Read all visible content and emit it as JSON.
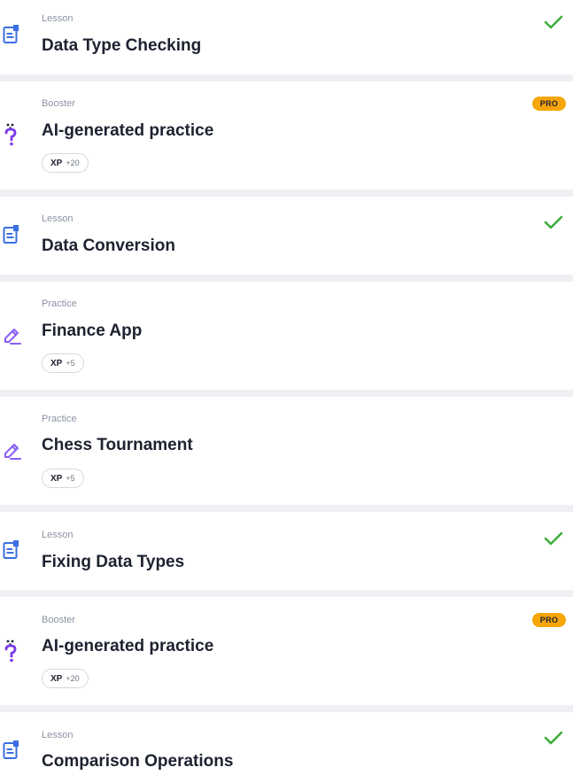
{
  "items": [
    {
      "type": "Lesson",
      "title": "Data Type Checking",
      "icon": "lesson-icon",
      "status": "completed"
    },
    {
      "type": "Booster",
      "title": "AI-generated practice",
      "icon": "question-icon",
      "badge": "PRO",
      "xp_label": "XP",
      "xp_value": "+20"
    },
    {
      "type": "Lesson",
      "title": "Data Conversion",
      "icon": "lesson-icon",
      "status": "completed"
    },
    {
      "type": "Practice",
      "title": "Finance App",
      "icon": "pencil-icon",
      "xp_label": "XP",
      "xp_value": "+5"
    },
    {
      "type": "Practice",
      "title": "Chess Tournament",
      "icon": "pencil-icon",
      "xp_label": "XP",
      "xp_value": "+5"
    },
    {
      "type": "Lesson",
      "title": "Fixing Data Types",
      "icon": "lesson-icon",
      "status": "completed"
    },
    {
      "type": "Booster",
      "title": "AI-generated practice",
      "icon": "question-icon",
      "badge": "PRO",
      "xp_label": "XP",
      "xp_value": "+20"
    },
    {
      "type": "Lesson",
      "title": "Comparison Operations",
      "icon": "lesson-icon",
      "status": "completed"
    }
  ],
  "colors": {
    "lesson_icon": "#3b6fe0",
    "practice_icon": "#8a5cf6",
    "booster_icon": "#7c3aed",
    "check": "#3fae3b",
    "pro_badge": "#f6a609"
  }
}
